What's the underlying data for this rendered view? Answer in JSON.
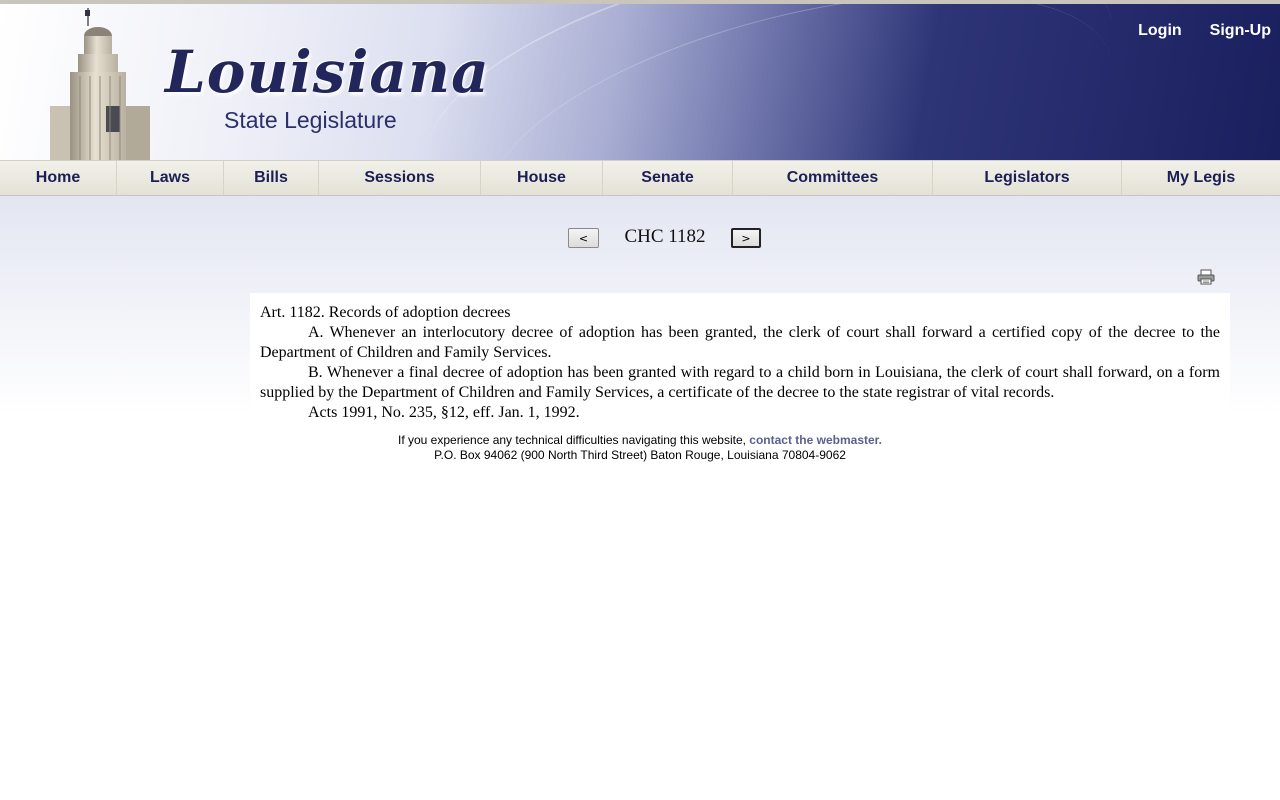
{
  "header": {
    "logo_script": "Louisiana",
    "logo_sub": "State Legislature",
    "login_label": "Login",
    "signup_label": "Sign-Up"
  },
  "nav": {
    "items": [
      "Home",
      "Laws",
      "Bills",
      "Sessions",
      "House",
      "Senate",
      "Committees",
      "Legislators",
      "My Legis"
    ]
  },
  "pager": {
    "prev_label": "<",
    "next_label": ">",
    "title": "CHC 1182"
  },
  "print_icon": "printer-icon",
  "document": {
    "heading": "Art. 1182.  Records of adoption decrees",
    "para_a": "A.  Whenever an interlocutory decree of adoption has been granted, the clerk of court shall forward a certified copy of the decree to the Department of Children and Family Services.",
    "para_b": "B.  Whenever a final decree of adoption has been granted with regard to a child born in Louisiana, the clerk of court shall forward, on a form supplied by the Department of Children and Family Services, a certificate of the decree to the state registrar of vital records.",
    "acts": "Acts 1991, No. 235, §12, eff. Jan. 1, 1992."
  },
  "footer": {
    "text": "If you experience any technical difficulties navigating this website, ",
    "link": "contact the webmaster.",
    "address": "P.O. Box 94062 (900 North Third Street) Baton Rouge, Louisiana 70804-9062"
  }
}
